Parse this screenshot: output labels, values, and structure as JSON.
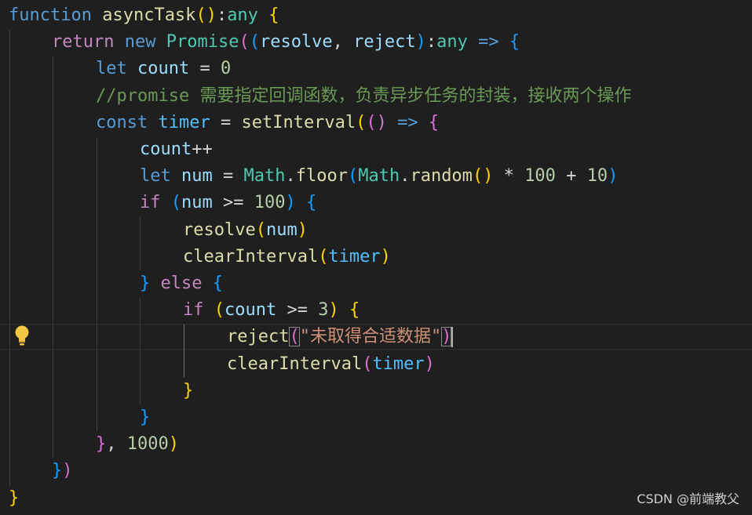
{
  "editor": {
    "lines": [
      {
        "tokens": [
          {
            "text": "function",
            "style": "st"
          },
          {
            "text": " ",
            "style": "pn"
          },
          {
            "text": "asyncTask",
            "style": "fn"
          },
          {
            "text": "(",
            "style": "b1"
          },
          {
            "text": ")",
            "style": "b1"
          },
          {
            "text": ":",
            "style": "pn"
          },
          {
            "text": "any",
            "style": "cls"
          },
          {
            "text": " ",
            "style": "pn"
          },
          {
            "text": "{",
            "style": "b1"
          }
        ]
      },
      {
        "tokens": [
          {
            "text": "return",
            "style": "kw"
          },
          {
            "text": " ",
            "style": "pn"
          },
          {
            "text": "new",
            "style": "st"
          },
          {
            "text": " ",
            "style": "pn"
          },
          {
            "text": "Promise",
            "style": "cls"
          },
          {
            "text": "(",
            "style": "b2"
          },
          {
            "text": "(",
            "style": "b3"
          },
          {
            "text": "resolve",
            "style": "var"
          },
          {
            "text": ", ",
            "style": "pn"
          },
          {
            "text": "reject",
            "style": "var"
          },
          {
            "text": ")",
            "style": "b3"
          },
          {
            "text": ":",
            "style": "pn"
          },
          {
            "text": "any",
            "style": "cls"
          },
          {
            "text": " ",
            "style": "pn"
          },
          {
            "text": "=>",
            "style": "st"
          },
          {
            "text": " ",
            "style": "pn"
          },
          {
            "text": "{",
            "style": "b3"
          }
        ]
      },
      {
        "tokens": [
          {
            "text": "let",
            "style": "st"
          },
          {
            "text": " ",
            "style": "pn"
          },
          {
            "text": "count",
            "style": "var"
          },
          {
            "text": " = ",
            "style": "pn"
          },
          {
            "text": "0",
            "style": "num"
          }
        ]
      },
      {
        "tokens": [
          {
            "text": "//promise 需要指定回调函数，负责异步任务的封装，接收两个操作",
            "style": "cm"
          }
        ]
      },
      {
        "tokens": [
          {
            "text": "const",
            "style": "st"
          },
          {
            "text": " ",
            "style": "pn"
          },
          {
            "text": "timer",
            "style": "cn"
          },
          {
            "text": " = ",
            "style": "pn"
          },
          {
            "text": "setInterval",
            "style": "fn"
          },
          {
            "text": "(",
            "style": "b1"
          },
          {
            "text": "(",
            "style": "b2"
          },
          {
            "text": ")",
            "style": "b2"
          },
          {
            "text": " ",
            "style": "pn"
          },
          {
            "text": "=>",
            "style": "st"
          },
          {
            "text": " ",
            "style": "pn"
          },
          {
            "text": "{",
            "style": "b2"
          }
        ]
      },
      {
        "tokens": [
          {
            "text": "count",
            "style": "var"
          },
          {
            "text": "++",
            "style": "pn"
          }
        ]
      },
      {
        "tokens": [
          {
            "text": "let",
            "style": "st"
          },
          {
            "text": " ",
            "style": "pn"
          },
          {
            "text": "num",
            "style": "var"
          },
          {
            "text": " = ",
            "style": "pn"
          },
          {
            "text": "Math",
            "style": "cls"
          },
          {
            "text": ".",
            "style": "pn"
          },
          {
            "text": "floor",
            "style": "fn"
          },
          {
            "text": "(",
            "style": "b3"
          },
          {
            "text": "Math",
            "style": "cls"
          },
          {
            "text": ".",
            "style": "pn"
          },
          {
            "text": "random",
            "style": "fn"
          },
          {
            "text": "(",
            "style": "b1"
          },
          {
            "text": ")",
            "style": "b1"
          },
          {
            "text": " * ",
            "style": "pn"
          },
          {
            "text": "100",
            "style": "num"
          },
          {
            "text": " + ",
            "style": "pn"
          },
          {
            "text": "10",
            "style": "num"
          },
          {
            "text": ")",
            "style": "b3"
          }
        ]
      },
      {
        "tokens": [
          {
            "text": "if",
            "style": "kw"
          },
          {
            "text": " ",
            "style": "pn"
          },
          {
            "text": "(",
            "style": "b3"
          },
          {
            "text": "num",
            "style": "var"
          },
          {
            "text": " >= ",
            "style": "pn"
          },
          {
            "text": "100",
            "style": "num"
          },
          {
            "text": ")",
            "style": "b3"
          },
          {
            "text": " ",
            "style": "pn"
          },
          {
            "text": "{",
            "style": "b3"
          }
        ]
      },
      {
        "tokens": [
          {
            "text": "resolve",
            "style": "fn"
          },
          {
            "text": "(",
            "style": "b1"
          },
          {
            "text": "num",
            "style": "var"
          },
          {
            "text": ")",
            "style": "b1"
          }
        ]
      },
      {
        "tokens": [
          {
            "text": "clearInterval",
            "style": "fn"
          },
          {
            "text": "(",
            "style": "b1"
          },
          {
            "text": "timer",
            "style": "cn"
          },
          {
            "text": ")",
            "style": "b1"
          }
        ]
      },
      {
        "tokens": [
          {
            "text": "}",
            "style": "b3"
          },
          {
            "text": " ",
            "style": "pn"
          },
          {
            "text": "else",
            "style": "kw"
          },
          {
            "text": " ",
            "style": "pn"
          },
          {
            "text": "{",
            "style": "b3"
          }
        ]
      },
      {
        "tokens": [
          {
            "text": "if",
            "style": "kw"
          },
          {
            "text": " ",
            "style": "pn"
          },
          {
            "text": "(",
            "style": "b1"
          },
          {
            "text": "count",
            "style": "var"
          },
          {
            "text": " >= ",
            "style": "pn"
          },
          {
            "text": "3",
            "style": "num"
          },
          {
            "text": ")",
            "style": "b1"
          },
          {
            "text": " ",
            "style": "pn"
          },
          {
            "text": "{",
            "style": "b1"
          }
        ]
      },
      {
        "tokens": [
          {
            "text": "reject",
            "style": "fn"
          },
          {
            "text": "(",
            "style": "b2",
            "match": true
          },
          {
            "text": "\"未取得合适数据\"",
            "style": "str"
          },
          {
            "text": ")",
            "style": "b2",
            "match": true
          },
          {
            "text": "",
            "style": "cursor"
          }
        ]
      },
      {
        "tokens": [
          {
            "text": "clearInterval",
            "style": "fn"
          },
          {
            "text": "(",
            "style": "b2"
          },
          {
            "text": "timer",
            "style": "cn"
          },
          {
            "text": ")",
            "style": "b2"
          }
        ]
      },
      {
        "tokens": [
          {
            "text": "}",
            "style": "b1"
          }
        ]
      },
      {
        "tokens": [
          {
            "text": "}",
            "style": "b3"
          }
        ]
      },
      {
        "tokens": [
          {
            "text": "}",
            "style": "b2"
          },
          {
            "text": ", ",
            "style": "pn"
          },
          {
            "text": "1000",
            "style": "num"
          },
          {
            "text": ")",
            "style": "b1"
          }
        ]
      },
      {
        "tokens": [
          {
            "text": "}",
            "style": "b3"
          },
          {
            "text": ")",
            "style": "b2"
          }
        ]
      },
      {
        "tokens": [
          {
            "text": "}",
            "style": "b1"
          }
        ]
      }
    ],
    "lightbulb_icon": "lightbulb-icon"
  },
  "watermark": {
    "text": "CSDN @前端教父"
  }
}
